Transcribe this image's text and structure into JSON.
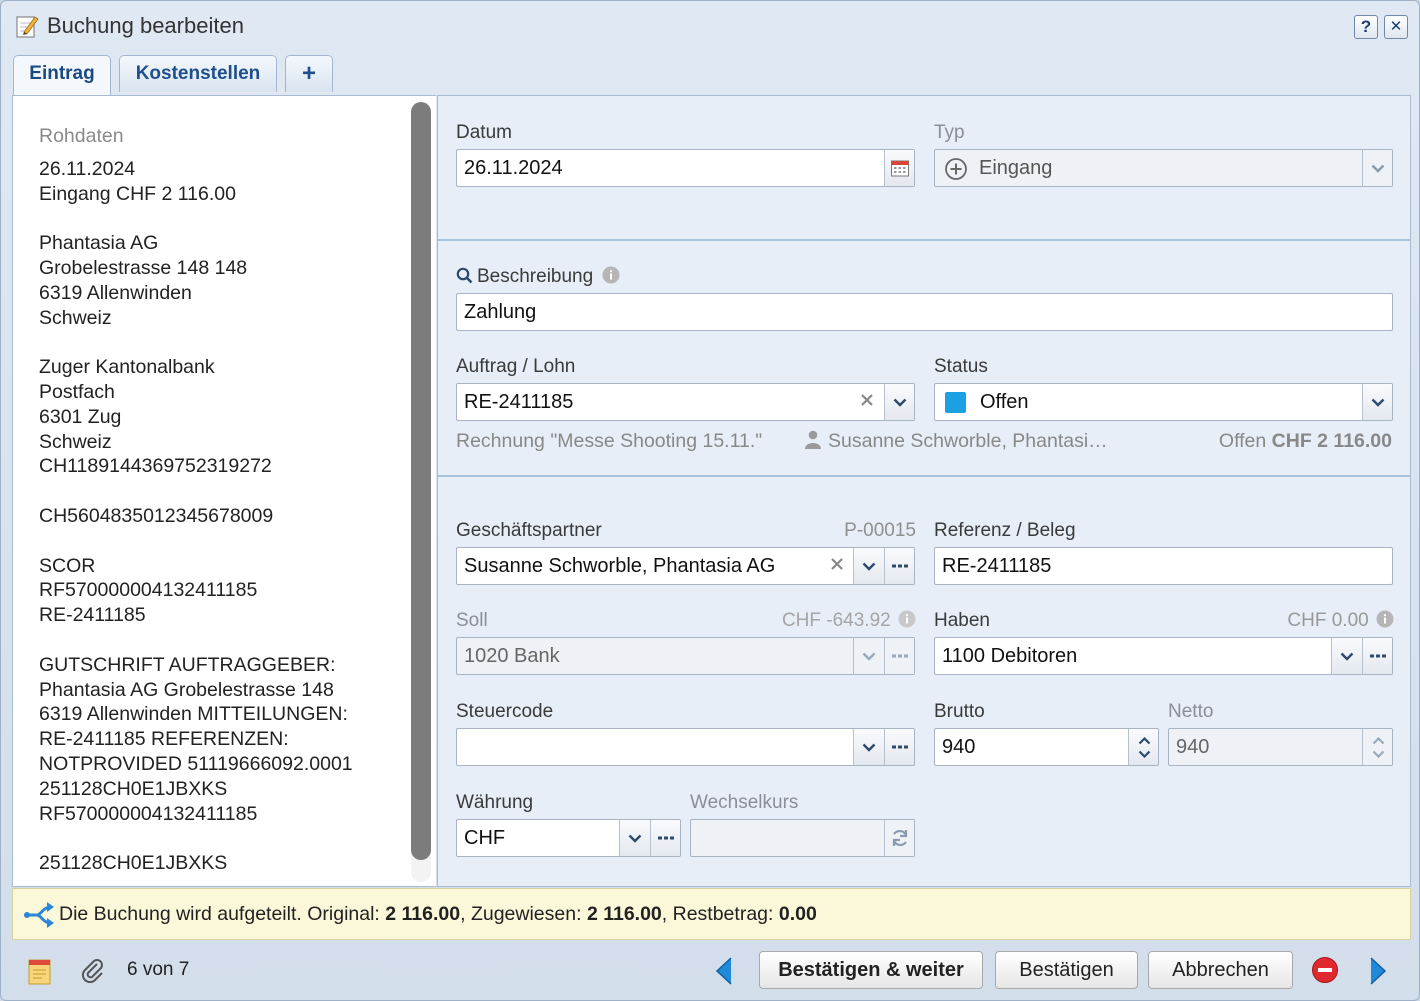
{
  "window": {
    "title": "Buchung bearbeiten",
    "help_label": "?",
    "close_label": "✕"
  },
  "tabs": [
    {
      "label": "Eintrag"
    },
    {
      "label": "Kostenstellen"
    },
    {
      "label": "+"
    }
  ],
  "raw": {
    "label": "Rohdaten",
    "lines": [
      "26.11.2024",
      "Eingang CHF 2 116.00",
      "",
      "Phantasia AG",
      "Grobelestrasse 148 148",
      "6319 Allenwinden",
      "Schweiz",
      "",
      "Zuger Kantonalbank",
      "Postfach",
      "6301 Zug",
      "Schweiz",
      "CH1189144369752319272",
      "",
      "CH5604835012345678009",
      "",
      "SCOR",
      "RF570000004132411185",
      "RE-2411185",
      "",
      "GUTSCHRIFT AUFTRAGGEBER:",
      "Phantasia AG Grobelestrasse 148",
      "6319 Allenwinden MITTEILUNGEN:",
      "RE-2411185 REFERENZEN:",
      "NOTPROVIDED 51119666092.0001",
      "251128CH0E1JBXKS",
      "RF570000004132411185",
      "",
      "251128CH0E1JBXKS"
    ]
  },
  "form": {
    "datum": {
      "label": "Datum",
      "value": "26.11.2024"
    },
    "typ": {
      "label": "Typ",
      "value": "Eingang"
    },
    "beschreibung": {
      "label": "Beschreibung",
      "value": "Zahlung"
    },
    "auftrag": {
      "label": "Auftrag / Lohn",
      "value": "RE-2411185"
    },
    "status": {
      "label": "Status",
      "value": "Offen",
      "color": "#1ba1e2"
    },
    "auftrag_info": {
      "rechnung": "Rechnung \"Messe Shooting 15.11.\"",
      "person": "Susanne Schworble, Phantasi…",
      "offen_prefix": "Offen",
      "offen_amount": "CHF 2 116.00"
    },
    "partner": {
      "label": "Geschäftspartner",
      "id": "P-00015",
      "value": "Susanne Schworble, Phantasia AG"
    },
    "referenz": {
      "label": "Referenz / Beleg",
      "value": "RE-2411185"
    },
    "soll": {
      "label": "Soll",
      "amount": "CHF -643.92",
      "value": "1020 Bank"
    },
    "haben": {
      "label": "Haben",
      "amount": "CHF 0.00",
      "value": "1100 Debitoren"
    },
    "steuercode": {
      "label": "Steuercode",
      "value": ""
    },
    "brutto": {
      "label": "Brutto",
      "value": "940"
    },
    "netto": {
      "label": "Netto",
      "value": "940"
    },
    "waehrung": {
      "label": "Währung",
      "value": "CHF"
    },
    "wechselkurs": {
      "label": "Wechselkurs",
      "value": ""
    }
  },
  "notice": {
    "text1": "Die Buchung wird aufgeteilt. Original: ",
    "original": "2 116.00",
    "text2": ", Zugewiesen: ",
    "zugewiesen": "2 116.00",
    "text3": ", Restbetrag: ",
    "rest": "0.00"
  },
  "footer": {
    "counter": "6 von 7",
    "confirm_next": "Bestätigen & weiter",
    "confirm": "Bestätigen",
    "cancel": "Abbrechen"
  },
  "colors": {
    "accent": "#1e4f8c",
    "status_blue": "#1ba1e2",
    "delete_red": "#e0282f",
    "nav_blue": "#1f8ad8"
  }
}
